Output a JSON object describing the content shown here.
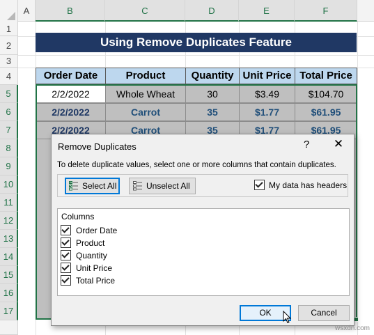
{
  "columns": [
    "A",
    "B",
    "C",
    "D",
    "E",
    "F"
  ],
  "rows": [
    "1",
    "2",
    "3",
    "4",
    "5",
    "6",
    "7",
    "8",
    "9",
    "10",
    "11",
    "12",
    "13",
    "14",
    "15",
    "16",
    "17"
  ],
  "title": "Using Remove Duplicates Feature",
  "table": {
    "headers": [
      "Order Date",
      "Product",
      "Quantity",
      "Unit Price",
      "Total Price"
    ],
    "rows": [
      [
        "2/2/2022",
        "Whole Wheat",
        "30",
        "$3.49",
        "$104.70"
      ],
      [
        "2/2/2022",
        "Carrot",
        "35",
        "$1.77",
        "$61.95"
      ],
      [
        "2/2/2022",
        "Carrot",
        "35",
        "$1.77",
        "$61.95"
      ]
    ]
  },
  "dialog": {
    "title": "Remove Duplicates",
    "help": "?",
    "close": "✕",
    "description": "To delete duplicate values, select one or more columns that contain duplicates.",
    "select_all": "Select All",
    "unselect_all": "Unselect All",
    "headers_checkbox": "My data has headers",
    "headers_checked": true,
    "columns_title": "Columns",
    "column_items": [
      "Order Date",
      "Product",
      "Quantity",
      "Unit Price",
      "Total Price"
    ],
    "ok": "OK",
    "cancel": "Cancel"
  },
  "watermark": "wsxdn.com",
  "colors": {
    "title_bg": "#203864",
    "header_bg": "#bdd7ee",
    "selection": "#217346",
    "dup_bg": "#bfbfbf"
  }
}
